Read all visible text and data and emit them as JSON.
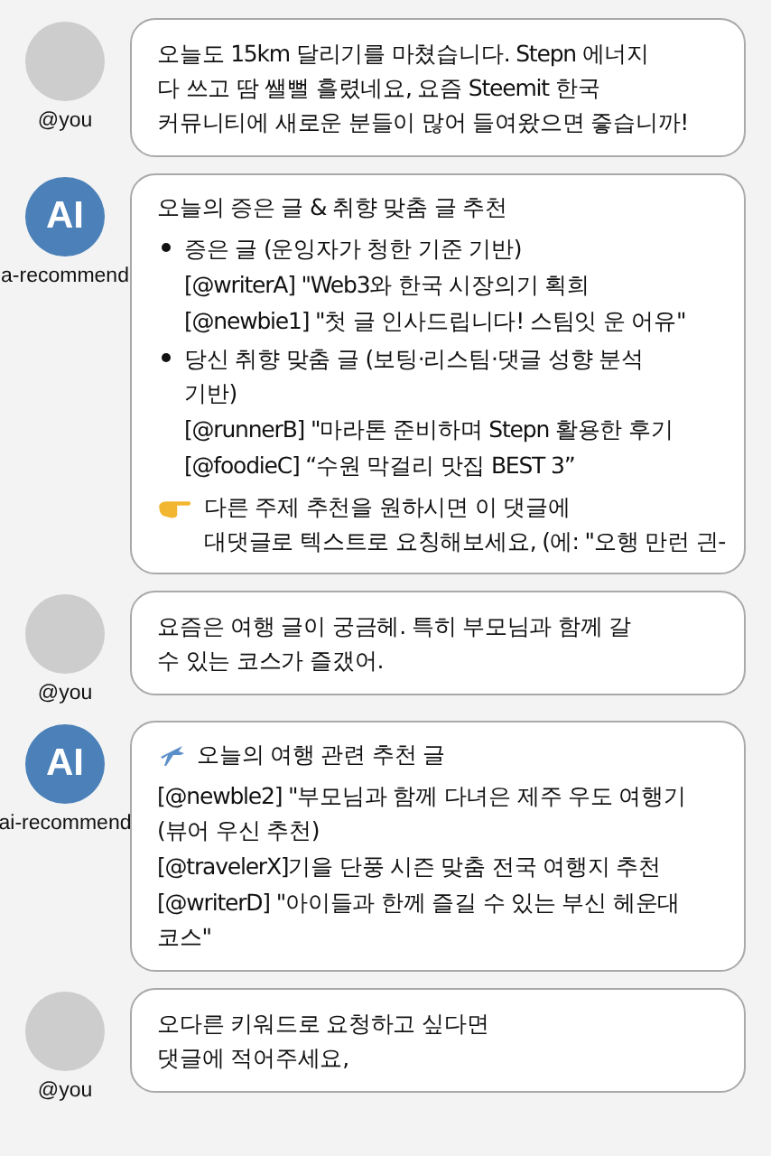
{
  "messages": [
    {
      "kind": "user",
      "handle": "@you",
      "blocks": [
        {
          "kind": "line",
          "text": "오늘도 15km 달리기를 마쳤습니다. Stepn 에너지\n다 쓰고 땀 쌜뻘 흘렸네요, 요즘 Steemit 한국\n커뮤니티에 새로운 분들이 많어 들여왔으면 즣습니까!"
        }
      ]
    },
    {
      "kind": "ai",
      "avatar": "AI",
      "handle": "a-recommend",
      "blocks": [
        {
          "kind": "heading",
          "text": "오늘의 증은 글 & 취향 맞춤 글 추천"
        },
        {
          "kind": "bullet",
          "text": "증은 글 (운잉자가 청한 기준 기반)"
        },
        {
          "kind": "sub",
          "text": "[@writerA] \"Web3와 한국 시장의기 획희"
        },
        {
          "kind": "sub",
          "text": "[@newbie1] \"첫 글 인사드립니다! 스팀잇 운 어유\""
        },
        {
          "kind": "bullet",
          "text": "당신 취향 맞춤 글 (보팅·리스팀·댓글 성향 분석\n기반)"
        },
        {
          "kind": "sub",
          "text": "[@runnerB] \"마라톤 준비하며 Stepn 활용한 후기"
        },
        {
          "kind": "sub",
          "text": "[@foodieC] “수원 막걸리 맛집 BEST 3”"
        },
        {
          "kind": "note",
          "text": "다른 주제 추천을 원하시면 이 댓글에\n대댓글로 텍스트로 요칭해보세요, (에: \"오행 만런 긘-"
        }
      ]
    },
    {
      "kind": "user",
      "handle": "@you",
      "blocks": [
        {
          "kind": "line",
          "text": "요즘은 여행 글이 궁금헤. 특히 부모님과 함께 갈\n수 있는 코스가 즐갰어."
        }
      ]
    },
    {
      "kind": "ai",
      "avatar": "AI",
      "handle": "ai-recommend",
      "blocks": [
        {
          "kind": "icon-heading",
          "text": "오늘의 여행 관련 추천 글"
        },
        {
          "kind": "line",
          "text": "[@newble2] \"부모님과 함께 다녀은 제주 우도 여행기\n  (뷰어 우신 추천)"
        },
        {
          "kind": "line",
          "text": "[@travelerX]기을 단풍 시즌 맞춤 전국 여행지 추천"
        },
        {
          "kind": "line",
          "text": "[@writerD] \"아이들과 한께 즐길 수 있는 부신 헤운대\n코스\""
        }
      ]
    },
    {
      "kind": "user",
      "handle": "@you",
      "blocks": [
        {
          "kind": "line",
          "text": "오다른 키워드로 요청하고 싶다면\n댓글에 적어주세요,"
        }
      ]
    }
  ]
}
